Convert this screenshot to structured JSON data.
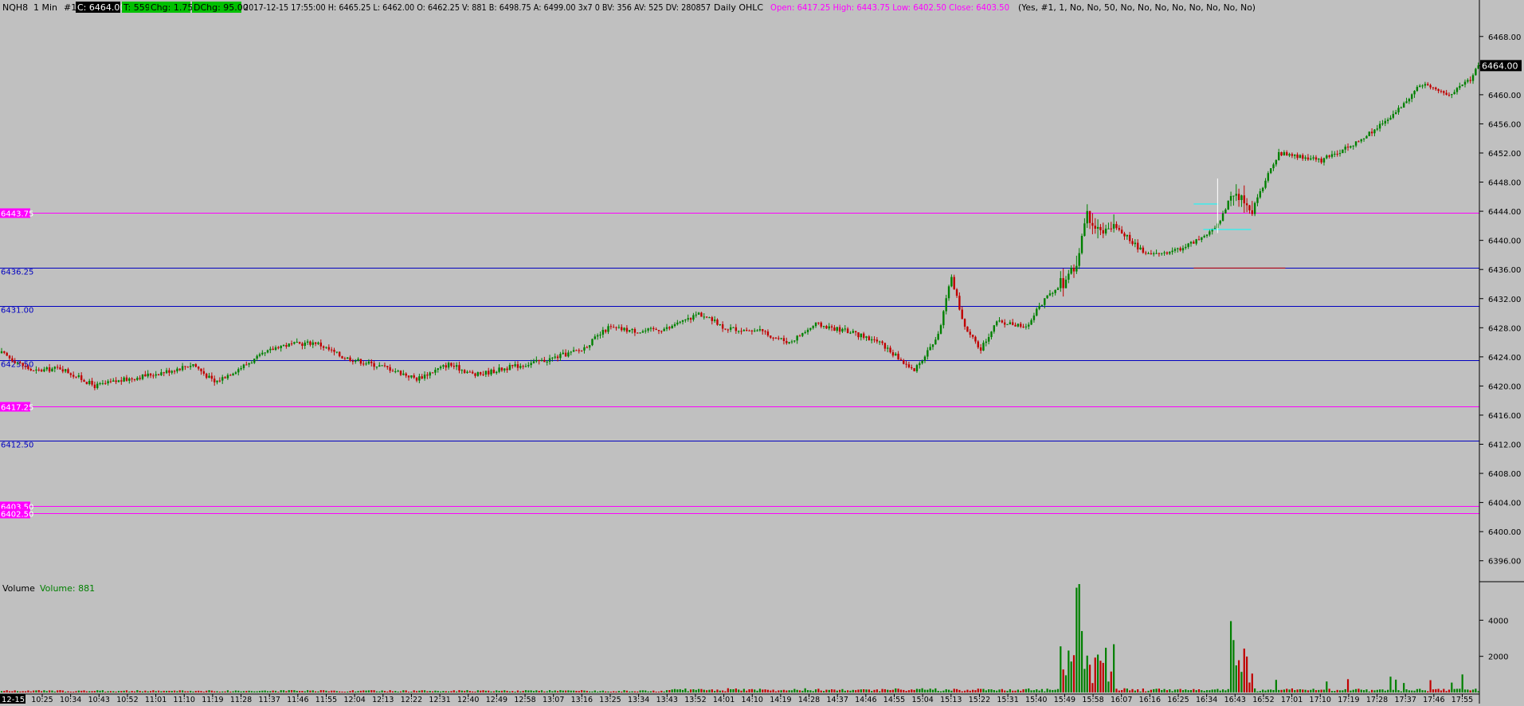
{
  "header": {
    "symbol": "NQH8",
    "interval": "1 Min",
    "chart_num": "#1",
    "last": "C: 6464.00",
    "ticks": "T: 559",
    "chg": "Chg: 1.75",
    "dchg": "DChg: 95.00",
    "stats": "2017-12-15 17:55:00 H: 6465.25 L: 6462.00 O: 6462.25 V: 881 B: 6498.75 A: 6499.00 3x7 0 BV: 356 AV: 525 DV: 280857",
    "study": "Daily OHLC",
    "ohlc": "Open: 6417.25  High: 6443.75  Low: 6402.50  Close: 6403.50",
    "params": "(Yes, #1, 1, No, No, 50, No, No, No, No, No, No, No, No)"
  },
  "colors": {
    "background": "#c0c0c0",
    "up": "#008000",
    "down": "#c00000",
    "daily_ohlc_line": "#ff00ff",
    "pivot_line": "#0000c0",
    "chg_badge": "#00c000",
    "cursor": "#ffffff",
    "crosshair": "#00ffff",
    "volume_text": "#008000"
  },
  "price_axis": {
    "ticks": [
      "6468.00",
      "6464.00",
      "6460.00",
      "6456.00",
      "6452.00",
      "6448.00",
      "6444.00",
      "6440.00",
      "6436.00",
      "6432.00",
      "6428.00",
      "6424.00",
      "6420.00",
      "6416.00",
      "6412.00",
      "6408.00",
      "6404.00",
      "6400.00",
      "6396.00"
    ],
    "current_label": "6464.00",
    "current_price": 6464.0
  },
  "levels": [
    {
      "price": 6443.75,
      "label": "6443.75",
      "kind": "ohlc"
    },
    {
      "price": 6436.25,
      "label": "6436.25",
      "kind": "pivot"
    },
    {
      "price": 6431.0,
      "label": "6431.00",
      "kind": "pivot"
    },
    {
      "price": 6423.5,
      "label": "6423.50",
      "kind": "pivot"
    },
    {
      "price": 6417.25,
      "label": "6417.25",
      "kind": "ohlc"
    },
    {
      "price": 6412.5,
      "label": "6412.50",
      "kind": "pivot"
    },
    {
      "price": 6403.5,
      "label": "6403.50",
      "kind": "ohlc"
    },
    {
      "price": 6402.5,
      "label": "6402.50",
      "kind": "ohlc"
    }
  ],
  "volume_panel": {
    "title": "Volume",
    "readout": "Volume: 881",
    "axis_ticks": [
      "4000",
      "2000"
    ]
  },
  "time_axis": {
    "first_label": "12-15",
    "labels": [
      "10:25",
      "10:34",
      "10:43",
      "10:52",
      "11:01",
      "11:10",
      "11:19",
      "11:28",
      "11:37",
      "11:46",
      "11:55",
      "12:04",
      "12:13",
      "12:22",
      "12:31",
      "12:40",
      "12:49",
      "12:58",
      "13:07",
      "13:16",
      "13:25",
      "13:34",
      "13:43",
      "13:52",
      "14:01",
      "14:10",
      "14:19",
      "14:28",
      "14:37",
      "14:46",
      "14:55",
      "15:04",
      "15:13",
      "15:22",
      "15:31",
      "15:40",
      "15:49",
      "15:58",
      "16:07",
      "16:16",
      "16:25",
      "16:34",
      "16:43",
      "16:52",
      "17:01",
      "17:10",
      "17:19",
      "17:28",
      "17:37",
      "17:46",
      "17:55"
    ]
  },
  "chart_data": {
    "type": "candlestick",
    "bar_interval": "1 Min",
    "bar_count": 450,
    "y_range": [
      6394,
      6470
    ],
    "volume_range": [
      0,
      6000
    ],
    "path_anchors": [
      [
        0,
        6424.5
      ],
      [
        12,
        6422.0
      ],
      [
        22,
        6422.5
      ],
      [
        35,
        6420.0
      ],
      [
        48,
        6421.0
      ],
      [
        62,
        6422.0
      ],
      [
        72,
        6423.0
      ],
      [
        80,
        6420.5
      ],
      [
        92,
        6423.0
      ],
      [
        104,
        6425.5
      ],
      [
        118,
        6426.0
      ],
      [
        128,
        6424.0
      ],
      [
        145,
        6422.5
      ],
      [
        156,
        6421.0
      ],
      [
        168,
        6423.0
      ],
      [
        178,
        6421.5
      ],
      [
        190,
        6422.5
      ],
      [
        204,
        6423.5
      ],
      [
        218,
        6425.0
      ],
      [
        228,
        6428.0
      ],
      [
        240,
        6427.5
      ],
      [
        252,
        6428.0
      ],
      [
        262,
        6430.0
      ],
      [
        272,
        6428.0
      ],
      [
        285,
        6427.5
      ],
      [
        296,
        6426.0
      ],
      [
        306,
        6428.5
      ],
      [
        318,
        6427.5
      ],
      [
        330,
        6426.0
      ],
      [
        343,
        6422.0
      ],
      [
        352,
        6427.0
      ],
      [
        357,
        6435.0
      ],
      [
        362,
        6428.0
      ],
      [
        368,
        6425.0
      ],
      [
        374,
        6429.0
      ],
      [
        385,
        6428.0
      ],
      [
        392,
        6432.0
      ],
      [
        400,
        6434.5
      ],
      [
        404,
        6437.0
      ],
      [
        408,
        6443.5
      ],
      [
        414,
        6441.0
      ],
      [
        420,
        6441.5
      ],
      [
        430,
        6438.0
      ],
      [
        440,
        6438.5
      ],
      [
        450,
        6440.0
      ],
      [
        456,
        6441.5
      ],
      [
        462,
        6446.0
      ],
      [
        470,
        6444.5
      ],
      [
        480,
        6452.0
      ],
      [
        496,
        6451.0
      ],
      [
        512,
        6454.0
      ],
      [
        522,
        6457.0
      ],
      [
        534,
        6461.5
      ],
      [
        544,
        6460.0
      ],
      [
        552,
        6462.0
      ],
      [
        555,
        6464.0
      ]
    ]
  }
}
